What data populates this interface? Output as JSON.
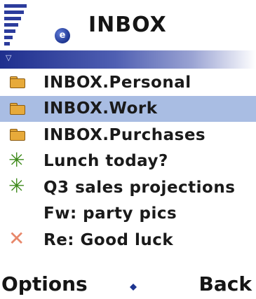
{
  "header": {
    "title": "INBOX",
    "icon": "mail-icon",
    "strip_icon": "signal-antenna-icon"
  },
  "list": {
    "items": [
      {
        "label": "INBOX.Personal",
        "icon": "folder-icon",
        "selected": false
      },
      {
        "label": "INBOX.Work",
        "icon": "folder-icon",
        "selected": true
      },
      {
        "label": "INBOX.Purchases",
        "icon": "folder-icon",
        "selected": false
      },
      {
        "label": "Lunch today?",
        "icon": "new-message-icon",
        "selected": false
      },
      {
        "label": "Q3 sales projections",
        "icon": "new-message-icon",
        "selected": false
      },
      {
        "label": "Fw: party pics",
        "icon": "",
        "selected": false
      },
      {
        "label": "Re: Good luck",
        "icon": "replied-message-icon",
        "selected": false
      }
    ]
  },
  "softkeys": {
    "left": "Options",
    "right": "Back"
  },
  "colors": {
    "selection": "#a9bde3",
    "strip_start": "#1f2f8e",
    "folder": "#e7aa3a",
    "new_icon": "#3e8a1b",
    "reply_icon": "#e8876a"
  }
}
